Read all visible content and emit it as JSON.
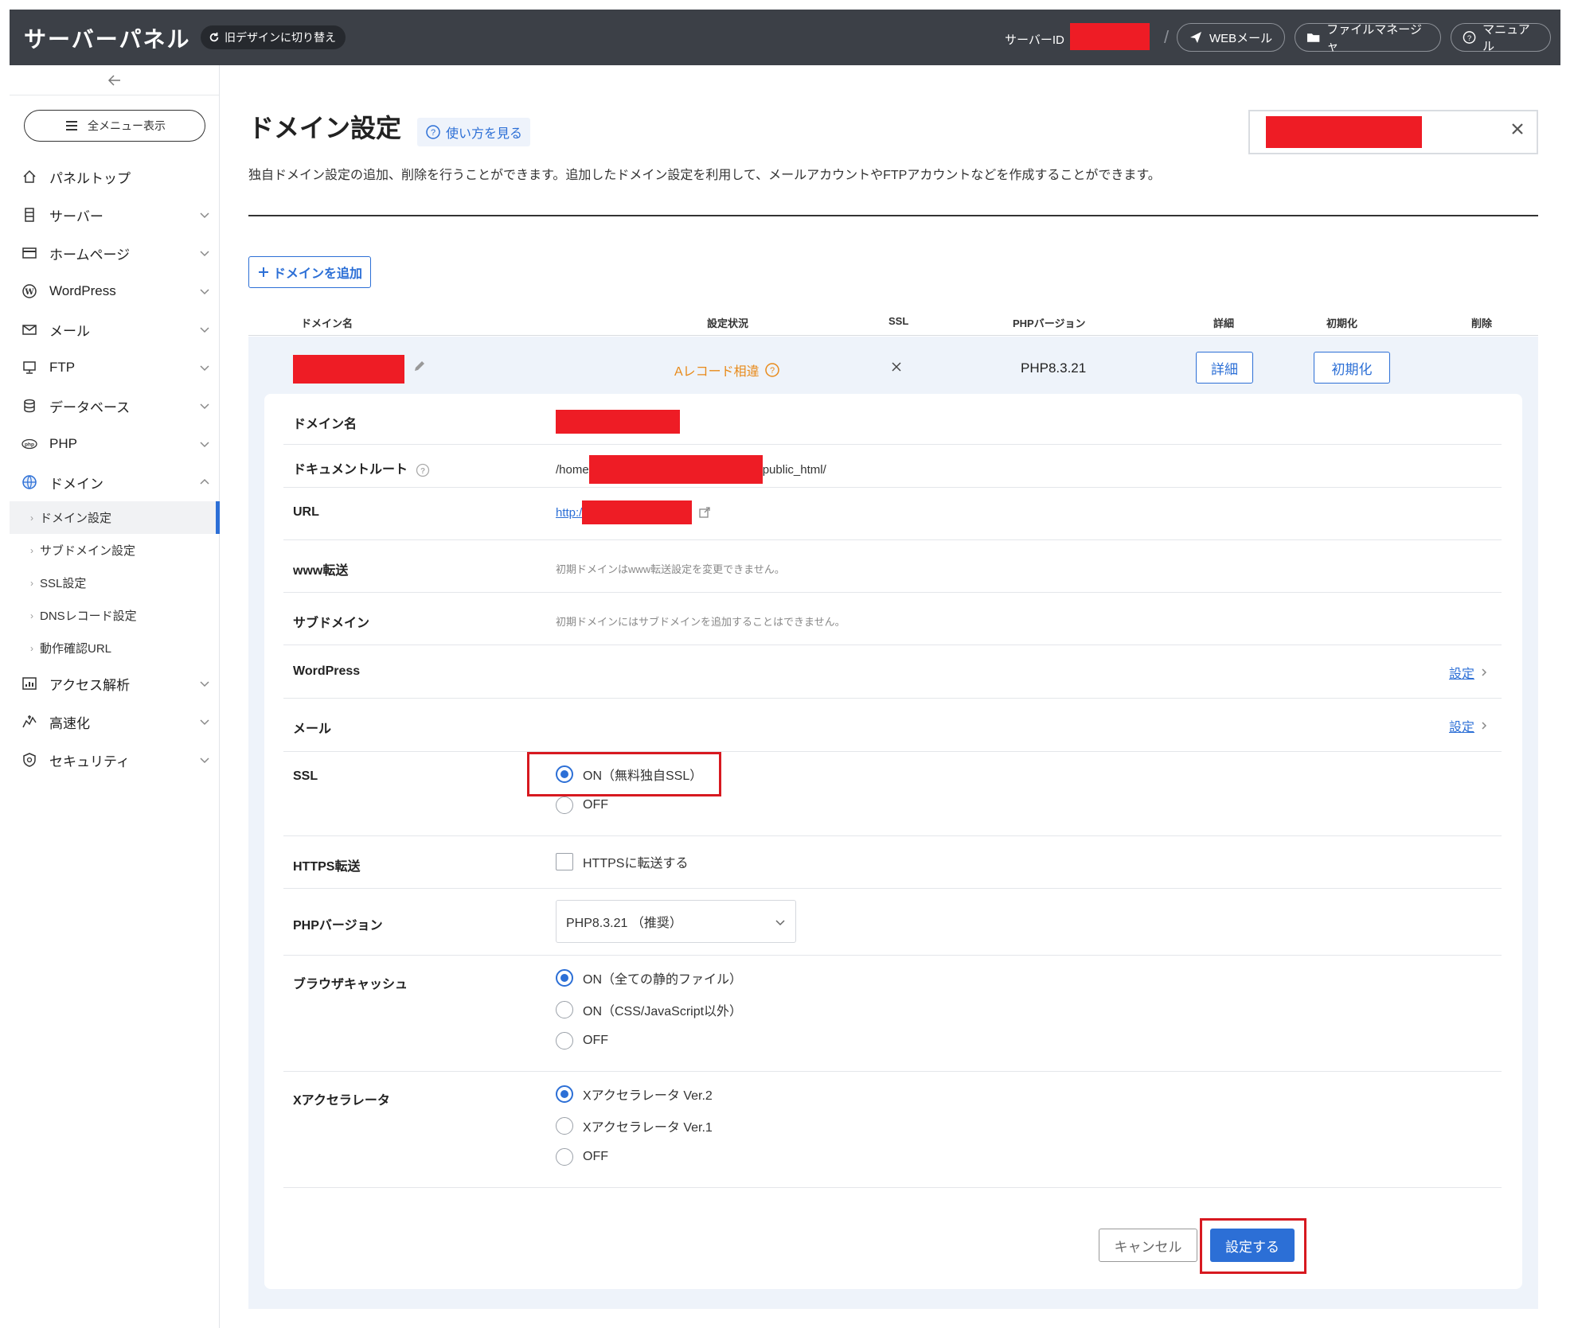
{
  "topbar": {
    "brand": "サーバーパネル",
    "old_design": "旧デザインに切り替え",
    "server_id_label": "サーバーID",
    "slash": "/",
    "webmail": "WEBメール",
    "file_manager": "ファイルマネージャ",
    "manual": "マニュアル"
  },
  "sidebar": {
    "menu_all": "全メニュー表示",
    "items": [
      {
        "label": "パネルトップ",
        "icon": "home-icon"
      },
      {
        "label": "サーバー",
        "icon": "server-icon"
      },
      {
        "label": "ホームページ",
        "icon": "browser-icon"
      },
      {
        "label": "WordPress",
        "icon": "wordpress-icon"
      },
      {
        "label": "メール",
        "icon": "mail-icon"
      },
      {
        "label": "FTP",
        "icon": "ftp-icon"
      },
      {
        "label": "データベース",
        "icon": "database-icon"
      },
      {
        "label": "PHP",
        "icon": "php-icon"
      },
      {
        "label": "ドメイン",
        "icon": "globe-icon"
      },
      {
        "label": "アクセス解析",
        "icon": "chart-icon"
      },
      {
        "label": "高速化",
        "icon": "speed-icon"
      },
      {
        "label": "セキュリティ",
        "icon": "shield-icon"
      }
    ],
    "domain_sub": [
      {
        "label": "ドメイン設定",
        "active": true
      },
      {
        "label": "サブドメイン設定"
      },
      {
        "label": "SSL設定"
      },
      {
        "label": "DNSレコード設定"
      },
      {
        "label": "動作確認URL"
      }
    ]
  },
  "main": {
    "title": "ドメイン設定",
    "howto": "使い方を見る",
    "description": "独自ドメイン設定の追加、削除を行うことができます。追加したドメイン設定を利用して、メールアカウントやFTPアカウントなどを作成することができます。",
    "add_domain": "ドメインを追加",
    "columns": [
      "ドメイン名",
      "設定状況",
      "SSL",
      "PHPバージョン",
      "詳細",
      "初期化",
      "削除"
    ],
    "row": {
      "status": "Aレコード相違",
      "ssl": "×",
      "php": "PHP8.3.21",
      "detail_btn": "詳細",
      "init_btn": "初期化"
    }
  },
  "detail": {
    "domain_name_label": "ドメイン名",
    "docroot_label": "ドキュメントルート",
    "docroot_prefix": "/home",
    "docroot_suffix": "public_html/",
    "url_label": "URL",
    "url_prefix": "http:/",
    "www_label": "www転送",
    "www_note": "初期ドメインはwww転送設定を変更できません。",
    "subdomain_label": "サブドメイン",
    "subdomain_note": "初期ドメインにはサブドメインを追加することはできません。",
    "wordpress_label": "WordPress",
    "mail_label": "メール",
    "settings_link": "設定",
    "ssl_label": "SSL",
    "ssl_on": "ON（無料独自SSL）",
    "ssl_off": "OFF",
    "https_label": "HTTPS転送",
    "https_check": "HTTPSに転送する",
    "php_label": "PHPバージョン",
    "php_selected": "PHP8.3.21 （推奨）",
    "cache_label": "ブラウザキャッシュ",
    "cache_opt1": "ON（全ての静的ファイル）",
    "cache_opt2": "ON（CSS/JavaScript以外）",
    "cache_opt3": "OFF",
    "xacc_label": "Xアクセラレータ",
    "xacc_opt1": "Xアクセラレータ Ver.2",
    "xacc_opt2": "Xアクセラレータ Ver.1",
    "xacc_opt3": "OFF",
    "cancel": "キャンセル",
    "submit": "設定する"
  },
  "colors": {
    "topbar": "#3c4047",
    "accent": "#2c6fd6",
    "warning": "#e88a1a",
    "highlight": "#d71920",
    "redaction": "#ee1c25"
  }
}
